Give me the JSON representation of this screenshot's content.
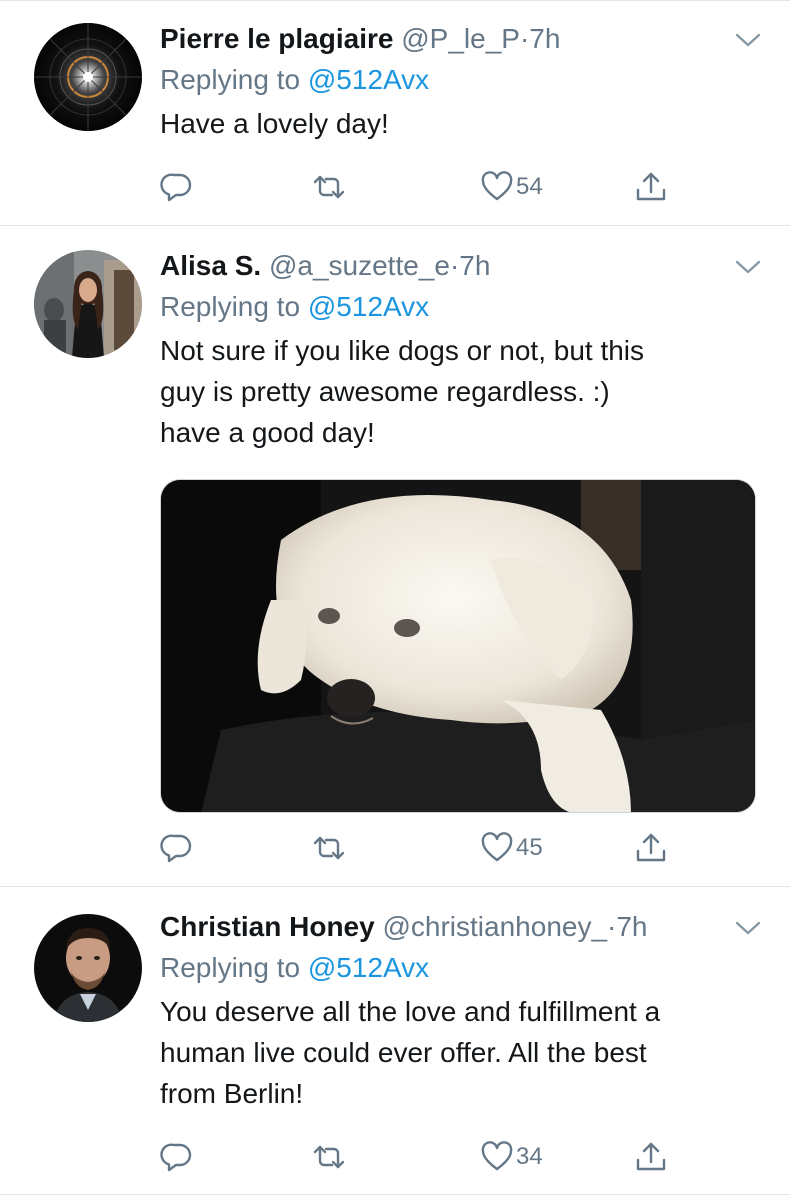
{
  "tweets": [
    {
      "name": "Pierre le plagiaire",
      "handle": "@P_le_P",
      "dot": "·",
      "time": "7h",
      "replying_prefix": "Replying to ",
      "replying_to": "@512Avx",
      "text_lines": [
        "Have a lovely day!"
      ],
      "likes": "54",
      "avatar_icon": "spiral-galaxy-avatar"
    },
    {
      "name": "Alisa S.",
      "handle": "@a_suzette_e",
      "dot": "·",
      "time": "7h",
      "replying_prefix": "Replying to ",
      "replying_to": "@512Avx",
      "text_lines": [
        "Not sure if you like dogs or not, but this",
        "guy is pretty awesome regardless. :)",
        "have a good day!"
      ],
      "likes": "45",
      "media": "white-puppy-photo",
      "avatar_icon": "woman-photo-avatar"
    },
    {
      "name": "Christian Honey",
      "handle": "@christianhoney_",
      "dot": "·",
      "time": "7h",
      "replying_prefix": "Replying to ",
      "replying_to": "@512Avx",
      "text_lines": [
        "You deserve all the love and fulfillment a",
        "human live could ever offer. All the best",
        "from Berlin!"
      ],
      "likes": "34",
      "avatar_icon": "man-photo-avatar"
    }
  ],
  "colors": {
    "link": "#1b95e0",
    "muted": "#657786",
    "divider": "#e1e8ed"
  },
  "icons": [
    "reply-icon",
    "retweet-icon",
    "like-icon",
    "share-icon",
    "chevron-down-icon"
  ]
}
